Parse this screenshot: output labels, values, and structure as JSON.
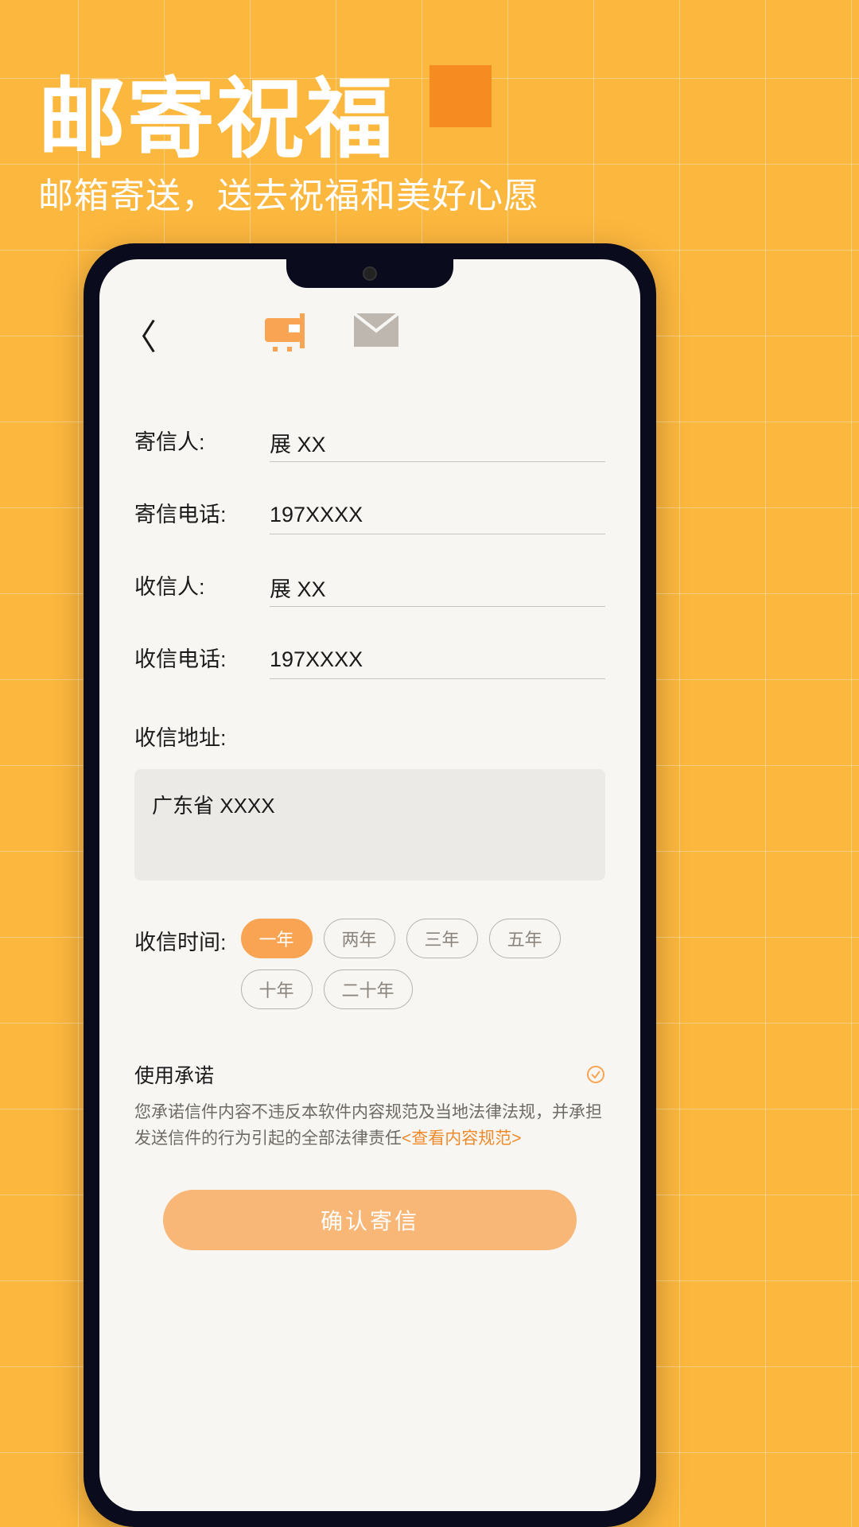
{
  "hero": {
    "title": "邮寄祝福",
    "subtitle": "邮箱寄送，送去祝福和美好心愿"
  },
  "form": {
    "sender_label": "寄信人:",
    "sender_value": "展 XX",
    "sender_phone_label": "寄信电话:",
    "sender_phone_value": "197XXXX",
    "recipient_label": "收信人:",
    "recipient_value": "展 XX",
    "recipient_phone_label": "收信电话:",
    "recipient_phone_value": "197XXXX",
    "address_label": "收信地址:",
    "address_value": "广东省 XXXX",
    "time_label": "收信时间:",
    "time_options": [
      "一年",
      "两年",
      "三年",
      "五年",
      "十年",
      "二十年"
    ],
    "time_selected": "一年"
  },
  "agreement": {
    "title": "使用承诺",
    "body": "您承诺信件内容不违反本软件内容规范及当地法律法规，并承担发送信件的行为引起的全部法律责任",
    "link": "<查看内容规范>"
  },
  "confirm_label": "确认寄信",
  "colors": {
    "accent": "#f9a452",
    "bg": "#fcb73e"
  }
}
